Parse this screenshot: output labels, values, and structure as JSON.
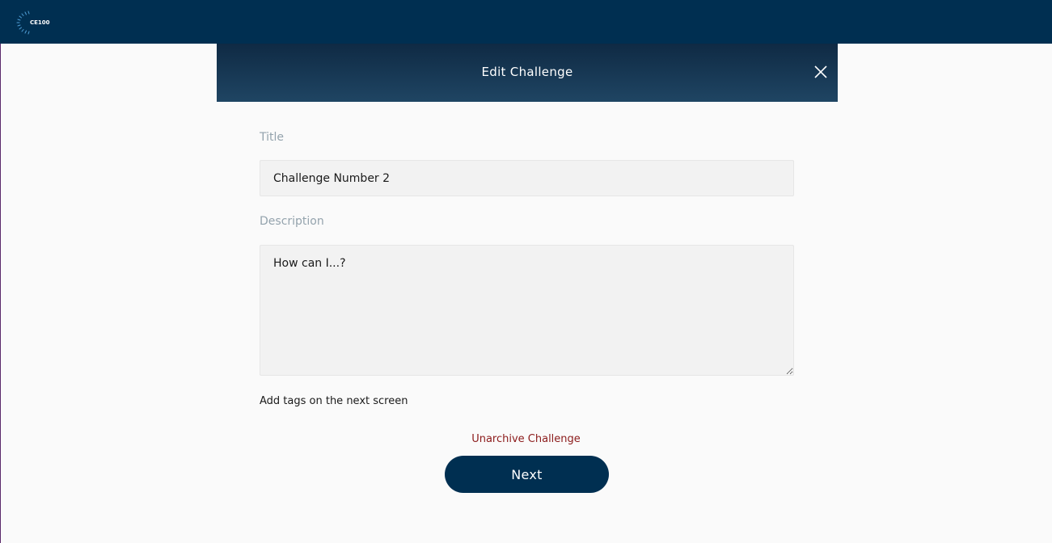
{
  "app": {
    "logo_text": "CE100"
  },
  "modal": {
    "title": "Edit Challenge",
    "close_icon": "close-icon"
  },
  "form": {
    "title_label": "Title",
    "title_value": "Challenge Number 2",
    "description_label": "Description",
    "description_value": "How can I...?",
    "tags_note": "Add tags on the next screen",
    "unarchive_label": "Unarchive Challenge",
    "next_label": "Next"
  },
  "colors": {
    "brand_navy": "#002f51",
    "danger_link": "#8b1a1a",
    "label_gray": "#94a3ad"
  }
}
